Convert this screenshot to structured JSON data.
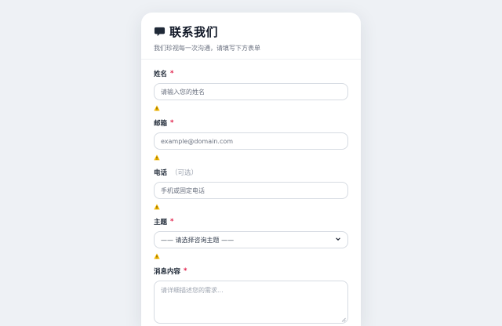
{
  "header": {
    "title": "联系我们",
    "subtitle": "我们珍视每一次沟通，请填写下方表单",
    "icon": "speech-bubble-icon"
  },
  "fields": {
    "name": {
      "label": "姓名",
      "required_mark": "*",
      "placeholder": "请输入您的姓名"
    },
    "email": {
      "label": "邮箱",
      "required_mark": "*",
      "placeholder": "example@domain.com"
    },
    "phone": {
      "label": "电话",
      "optional_note": "（可选）",
      "placeholder": "手机或固定电话"
    },
    "topic": {
      "label": "主题",
      "required_mark": "*",
      "selected": "—— 请选择咨询主题 ——"
    },
    "message": {
      "label": "消息内容",
      "required_mark": "*",
      "placeholder": "请详细描述您的需求..."
    }
  },
  "colors": {
    "required": "#e11d48",
    "warning": "#f5b800",
    "background": "#eef1f5"
  }
}
